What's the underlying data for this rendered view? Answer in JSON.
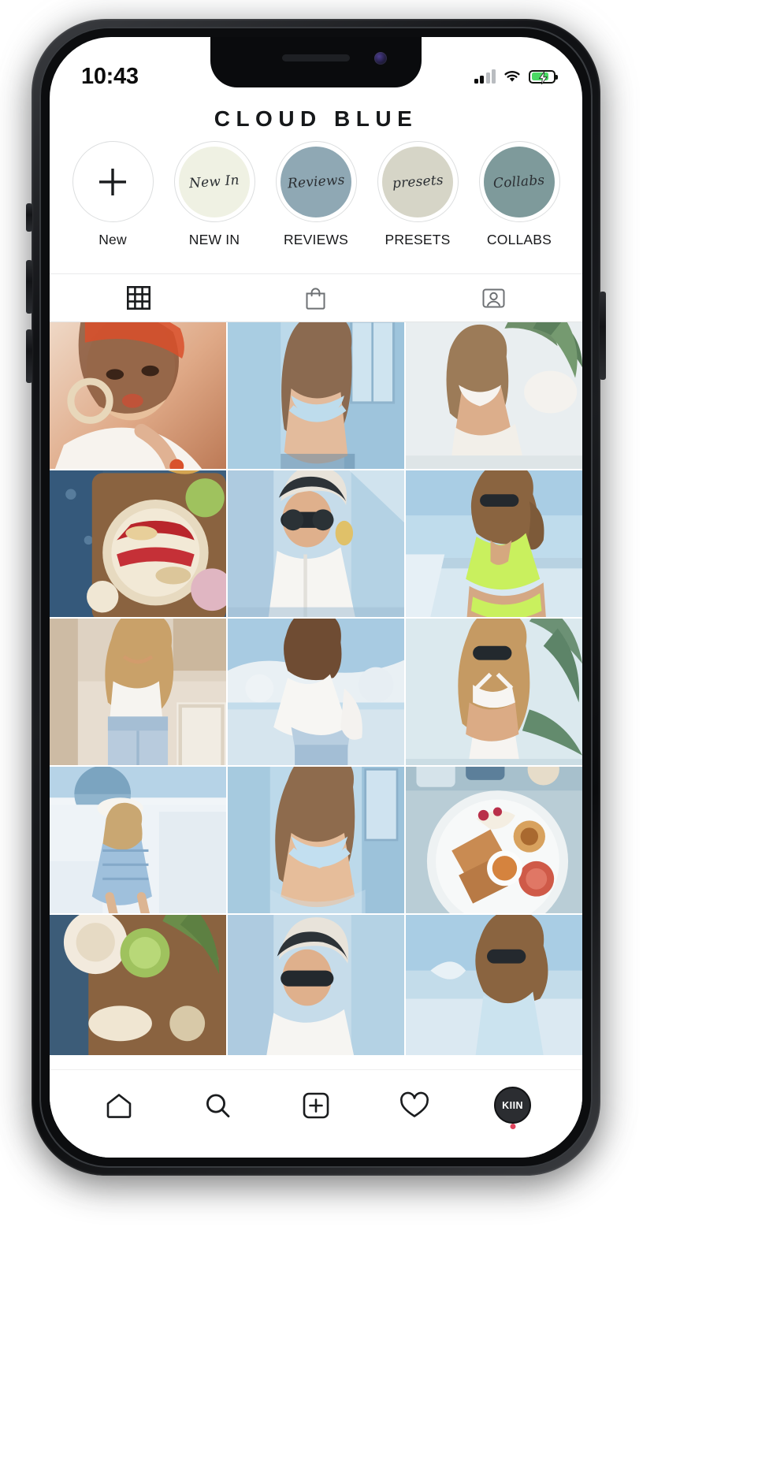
{
  "status_bar": {
    "time": "10:43",
    "signal_icon": "cellular-signal-icon",
    "wifi_icon": "wifi-icon",
    "battery_icon": "battery-charging-icon",
    "battery_color": "#4ad964"
  },
  "header": {
    "title": "CLOUD BLUE"
  },
  "highlights": [
    {
      "label": "New",
      "cover_text": "",
      "bg": "#ffffff",
      "is_add": true,
      "name": "highlight-new"
    },
    {
      "label": "NEW IN",
      "cover_text": "New In",
      "bg": "#eff1e3",
      "is_add": false,
      "name": "highlight-new-in"
    },
    {
      "label": "REVIEWS",
      "cover_text": "Reviews",
      "bg": "#8fa8b4",
      "is_add": false,
      "name": "highlight-reviews"
    },
    {
      "label": "PRESETS",
      "cover_text": "presets",
      "bg": "#d6d5c7",
      "is_add": false,
      "name": "highlight-presets"
    },
    {
      "label": "COLLABS",
      "cover_text": "Collabs",
      "bg": "#7e9a9b",
      "is_add": false,
      "name": "highlight-collabs"
    }
  ],
  "profile_tabs": [
    {
      "icon": "grid-icon",
      "name": "tab-grid",
      "active": true
    },
    {
      "icon": "bag-icon",
      "name": "tab-shop",
      "active": false
    },
    {
      "icon": "tagged-icon",
      "name": "tab-tagged",
      "active": false
    }
  ],
  "grid_posts": [
    {
      "alt": "portrait-woman-orange-lips-hoop-earrings",
      "p1": "#e8c4ab",
      "p2": "#c77f5e",
      "p3": "#f6ece4",
      "p4": "#8e5236"
    },
    {
      "alt": "woman-light-blue-bikini-against-blue-wall",
      "p1": "#b8d4e6",
      "p2": "#7fa8c9",
      "p3": "#e7eef3",
      "p4": "#4d6f8c"
    },
    {
      "alt": "woman-white-swimsuit-sunglasses-palms",
      "p1": "#dce7ec",
      "p2": "#9fb9a5",
      "p3": "#f3f1ea",
      "p4": "#6d8573"
    },
    {
      "alt": "smoothie-bowl-tropical-fruit-flatlay",
      "p1": "#d9c6a8",
      "p2": "#a53a3f",
      "p3": "#e9dcc6",
      "p4": "#3c5a78"
    },
    {
      "alt": "woman-white-blazer-headscarf-sunglasses",
      "p1": "#cfe0ea",
      "p2": "#8aa6bd",
      "p3": "#f2f5f7",
      "p4": "#3e566c"
    },
    {
      "alt": "woman-neon-green-swimsuit-poolside",
      "p1": "#bdd8e8",
      "p2": "#b7e04f",
      "p3": "#eaf3f8",
      "p4": "#5d7e99"
    },
    {
      "alt": "woman-white-top-jeans-cafe-interior",
      "p1": "#e5dbcf",
      "p2": "#c3a884",
      "p3": "#f7f3ec",
      "p4": "#7d6a55"
    },
    {
      "alt": "woman-off-shoulder-white-top-santorini",
      "p1": "#cfe2ee",
      "p2": "#9db8cc",
      "p3": "#f4f7f9",
      "p4": "#5b7387"
    },
    {
      "alt": "woman-white-bikini-sunglasses-palm-leaves",
      "p1": "#cfe4ea",
      "p2": "#86a88f",
      "p3": "#f1f2ee",
      "p4": "#54707c"
    },
    {
      "alt": "woman-blue-striped-dress-white-hat-rooftop",
      "p1": "#d7e6f0",
      "p2": "#93b2cc",
      "p3": "#f6f8fa",
      "p4": "#5f7d98"
    },
    {
      "alt": "woman-light-blue-bikini-portrait-closeup",
      "p1": "#bcd8ea",
      "p2": "#84a9c7",
      "p3": "#e9f1f6",
      "p4": "#4c6d8a"
    },
    {
      "alt": "brunch-plate-avocado-toast-tomatoes",
      "p1": "#cfd9dd",
      "p2": "#c97a4a",
      "p3": "#edeeea",
      "p4": "#6d8fa0"
    },
    {
      "alt": "coconut-lime-tropical-flatlay-partial",
      "p1": "#dcd0bc",
      "p2": "#9fb77e",
      "p3": "#f2ece0",
      "p4": "#6a7c55"
    },
    {
      "alt": "woman-headscarf-white-blazer-partial",
      "p1": "#cfe0ea",
      "p2": "#8aa6bd",
      "p3": "#f2f5f7",
      "p4": "#3e566c"
    },
    {
      "alt": "woman-sunglasses-poolside-partial",
      "p1": "#bdd8e8",
      "p2": "#9fc0a4",
      "p3": "#eaf3f8",
      "p4": "#5d7e99"
    }
  ],
  "bottom_nav": [
    {
      "icon": "home-icon",
      "name": "nav-home"
    },
    {
      "icon": "search-icon",
      "name": "nav-search"
    },
    {
      "icon": "add-post-icon",
      "name": "nav-create"
    },
    {
      "icon": "heart-icon",
      "name": "nav-activity"
    },
    {
      "icon": "profile-avatar-icon",
      "name": "nav-profile",
      "avatar_text": "KIIN"
    }
  ]
}
